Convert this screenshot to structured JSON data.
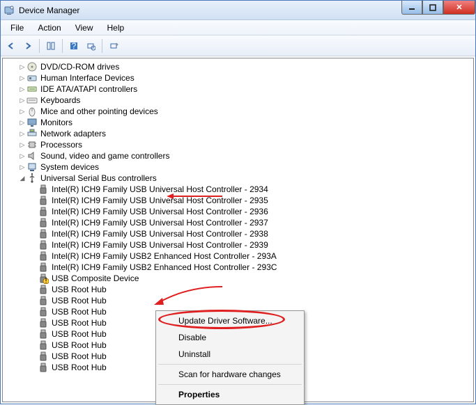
{
  "title": "Device Manager",
  "menu": {
    "file": "File",
    "action": "Action",
    "view": "View",
    "help": "Help"
  },
  "categories": [
    {
      "label": "DVD/CD-ROM drives",
      "icon": "disc-icon"
    },
    {
      "label": "Human Interface Devices",
      "icon": "hid-icon"
    },
    {
      "label": "IDE ATA/ATAPI controllers",
      "icon": "ide-icon"
    },
    {
      "label": "Keyboards",
      "icon": "keyboard-icon"
    },
    {
      "label": "Mice and other pointing devices",
      "icon": "mouse-icon"
    },
    {
      "label": "Monitors",
      "icon": "monitor-icon"
    },
    {
      "label": "Network adapters",
      "icon": "network-icon"
    },
    {
      "label": "Processors",
      "icon": "cpu-icon"
    },
    {
      "label": "Sound, video and game controllers",
      "icon": "sound-icon"
    },
    {
      "label": "System devices",
      "icon": "system-icon"
    }
  ],
  "usb": {
    "label": "Universal Serial Bus controllers",
    "children": [
      "Intel(R) ICH9 Family USB Universal Host Controller - 2934",
      "Intel(R) ICH9 Family USB Universal Host Controller - 2935",
      "Intel(R) ICH9 Family USB Universal Host Controller - 2936",
      "Intel(R) ICH9 Family USB Universal Host Controller - 2937",
      "Intel(R) ICH9 Family USB Universal Host Controller - 2938",
      "Intel(R) ICH9 Family USB Universal Host Controller - 2939",
      "Intel(R) ICH9 Family USB2 Enhanced Host Controller - 293A",
      "Intel(R) ICH9 Family USB2 Enhanced Host Controller - 293C",
      "USB Composite Device",
      "USB Root Hub",
      "USB Root Hub",
      "USB Root Hub",
      "USB Root Hub",
      "USB Root Hub",
      "USB Root Hub",
      "USB Root Hub",
      "USB Root Hub"
    ]
  },
  "context": {
    "update": "Update Driver Software...",
    "disable": "Disable",
    "uninstall": "Uninstall",
    "scan": "Scan for hardware changes",
    "properties": "Properties"
  }
}
